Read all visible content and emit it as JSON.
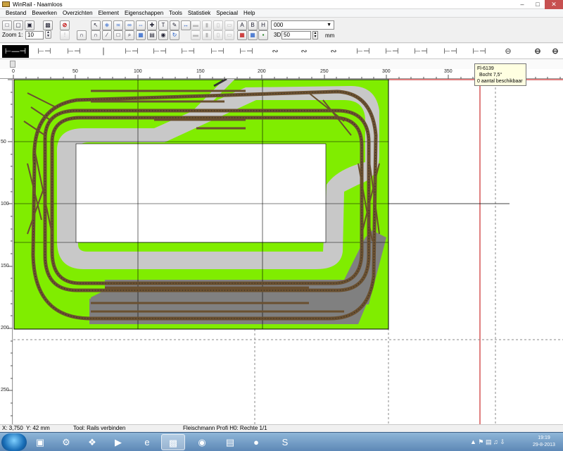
{
  "window": {
    "title": "WinRail - Naamloos",
    "controls": {
      "minimize": "–",
      "maximize": "□",
      "close": "✕"
    },
    "accent_close": "#c75050"
  },
  "menu": [
    "Bestand",
    "Bewerken",
    "Overzichten",
    "Element",
    "Eigenschappen",
    "Tools",
    "Statistiek",
    "Speciaal",
    "Help"
  ],
  "toolbar": {
    "zoom_label": "Zoom 1:",
    "zoom_value": "10",
    "layer_value": "000",
    "view3d_label": "3D:",
    "view3d_value": "50",
    "view3d_unit": "mm",
    "text_tool_label": "T",
    "font_buttons": [
      "A",
      "B",
      "H"
    ]
  },
  "palette": {
    "selected_index": 0,
    "items": [
      "straight-long-icon",
      "straight-icon",
      "straight-short-icon",
      "buffer-icon",
      "straight-icon",
      "straight-icon",
      "straight-icon",
      "straight-icon",
      "straight-icon",
      "flex-track-icon",
      "flex-track-icon",
      "curve-icon",
      "curve-icon",
      "curve-icon",
      "curve-icon",
      "straight-icon",
      "rerailer-icon",
      "rerailer-icon",
      "circle-track-icon",
      "circle-track-icon"
    ]
  },
  "ruler": {
    "top_labels": [
      "0",
      "50",
      "100",
      "150",
      "200",
      "250",
      "300",
      "350"
    ],
    "left_labels": [
      "50",
      "100",
      "150",
      "200",
      "250"
    ]
  },
  "tooltip": {
    "line1": "Fl-6139",
    "line2": "Bocht 7,5°",
    "line3": "0 aantal beschikbaar"
  },
  "status": {
    "x": "X: 3,750",
    "y": "Y: 42 mm",
    "tool": "Tool: Rails verbinden",
    "track": "Fleischmann Profi H0: Rechte 1/1"
  },
  "taskbar": {
    "apps": [
      "explorer-icon",
      "library-icon",
      "settings-icon",
      "network-icon",
      "media-icon",
      "ie-icon",
      "winrail-icon",
      "chrome-icon",
      "folder-icon",
      "paint-icon",
      "skype-icon"
    ],
    "active_index": 6,
    "clock_time": "19:19",
    "clock_date": "29-8-2013"
  },
  "colors": {
    "baseboard": "#80ed00",
    "road": "#c0c0c0",
    "dark_road": "#808080",
    "red_guide": "#c00000"
  }
}
